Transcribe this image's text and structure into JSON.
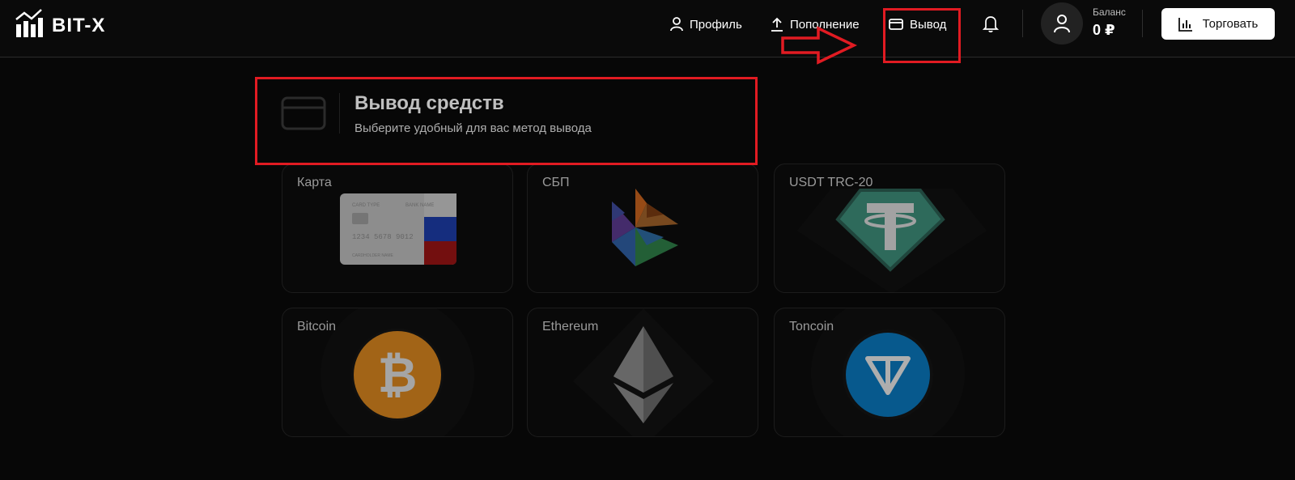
{
  "brand": {
    "name": "BIT-X"
  },
  "nav": {
    "profile": "Профиль",
    "deposit": "Пополнение",
    "withdraw": "Вывод"
  },
  "balance": {
    "label": "Баланс",
    "value": "0 ₽"
  },
  "trade_button": "Торговать",
  "page": {
    "title": "Вывод средств",
    "subtitle": "Выберите удобный для вас метод вывода"
  },
  "methods": [
    {
      "label": "Карта"
    },
    {
      "label": "СБП"
    },
    {
      "label": "USDT TRC-20"
    },
    {
      "label": "Bitcoin"
    },
    {
      "label": "Ethereum"
    },
    {
      "label": "Toncoin"
    }
  ],
  "bank_card": {
    "type_label": "CARD TYPE",
    "bank_label": "BANK NAME",
    "number": "1234  5678  9012",
    "holder": "CARDHOLDER NAME"
  },
  "colors": {
    "background": "#0a0a0a",
    "annotation_red": "#e11b22",
    "usdt_green": "#3e8e7a",
    "bitcoin_orange": "#d9861f",
    "toncoin_blue": "#0a77bd"
  },
  "icons": [
    "logo-bars-icon",
    "user-icon",
    "upload-icon",
    "wallet-icon",
    "bell-icon",
    "avatar-user-icon",
    "chart-icon",
    "card-icon"
  ]
}
